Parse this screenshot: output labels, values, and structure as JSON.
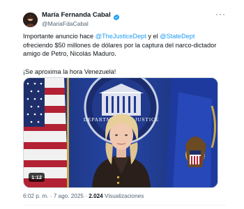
{
  "author": {
    "display_name": "María Fernanda Cabal",
    "handle": "@MariaFdaCabal"
  },
  "tweet": {
    "text_1": "Importante anuncio hace ",
    "mention_1": "@TheJusticeDept",
    "text_2": " y el ",
    "mention_2": "@StateDept",
    "text_3": " ofreciendo $50 millones de dólares por la captura del narco-dictador amigo de Petro, Nicolás Maduro.",
    "text_4": "¡Se aproxima la hora Venezuela!"
  },
  "media": {
    "duration": "1:12",
    "seal_text": "DEPARTMENT OF JUSTICE"
  },
  "meta": {
    "time": "6:02 p. m.",
    "separator": " · ",
    "date": "7 ago. 2025",
    "views_count": "2.024",
    "views_label": " Visualizaciones"
  },
  "colors": {
    "accent": "#1d9bf0",
    "text": "#0f1419",
    "secondary": "#536471"
  },
  "icons": {
    "verified": "verified-badge-icon",
    "more": "more-options-icon"
  }
}
